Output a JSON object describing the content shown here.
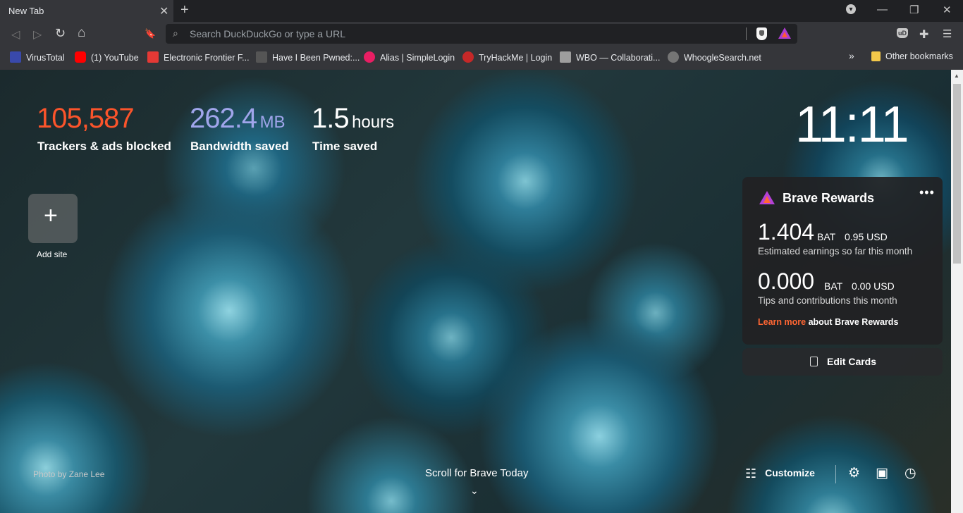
{
  "tab": {
    "title": "New Tab",
    "close": "✕",
    "new": "+"
  },
  "window": {
    "profile": "▾",
    "minimize": "—",
    "restore": "❐",
    "close": "✕"
  },
  "toolbar": {
    "back": "◁",
    "forward": "▷",
    "reload": "↻",
    "home": "⌂",
    "bookmark": "🔖",
    "search_icon": "⌕",
    "placeholder": "Search DuckDuckGo or type a URL",
    "ublock": "uD",
    "extensions": "✚",
    "menu": "☰"
  },
  "bookmarks": {
    "items": [
      {
        "label": "VirusTotal",
        "color": "#3949ab"
      },
      {
        "label": "(1) YouTube",
        "color": "#ff0000"
      },
      {
        "label": "Electronic Frontier F...",
        "color": "#e53935"
      },
      {
        "label": "Have I Been Pwned:...",
        "color": "#555555"
      },
      {
        "label": "Alias | SimpleLogin",
        "color": "#e91e63"
      },
      {
        "label": "TryHackMe | Login",
        "color": "#c62828"
      },
      {
        "label": "WBO — Collaborati...",
        "color": "#9e9e9e"
      },
      {
        "label": "WhoogleSearch.net",
        "color": "#757575"
      }
    ],
    "more": "»",
    "other": "Other bookmarks"
  },
  "stats": {
    "trackers": {
      "value": "105,587",
      "label": "Trackers & ads blocked",
      "color": "#fb542b"
    },
    "bandwidth": {
      "value": "262.4",
      "unit": "MB",
      "label": "Bandwidth saved",
      "color": "#a0a5eb"
    },
    "time": {
      "value": "1.5",
      "unit": "hours",
      "label": "Time saved"
    }
  },
  "clock": "11:11",
  "topsites": {
    "add_label": "Add site",
    "add_glyph": "+"
  },
  "rewards": {
    "title": "Brave Rewards",
    "menu": "•••",
    "earnings": {
      "bat": "1.404",
      "unit": "BAT",
      "usd": "0.95 USD",
      "label": "Estimated earnings so far this month"
    },
    "tips": {
      "bat": "0.000",
      "unit": "BAT",
      "usd": "0.00 USD",
      "label": "Tips and contributions this month"
    },
    "learn_link": "Learn more",
    "learn_text": "about Brave Rewards"
  },
  "edit_cards": "Edit Cards",
  "photo_credit": "Photo by Zane Lee",
  "scroll_label": "Scroll for Brave Today",
  "chevron": "⌄",
  "customize": {
    "icon": "☷",
    "label": "Customize",
    "settings": "⚙",
    "bookmarks": "▣",
    "history": "◷"
  }
}
